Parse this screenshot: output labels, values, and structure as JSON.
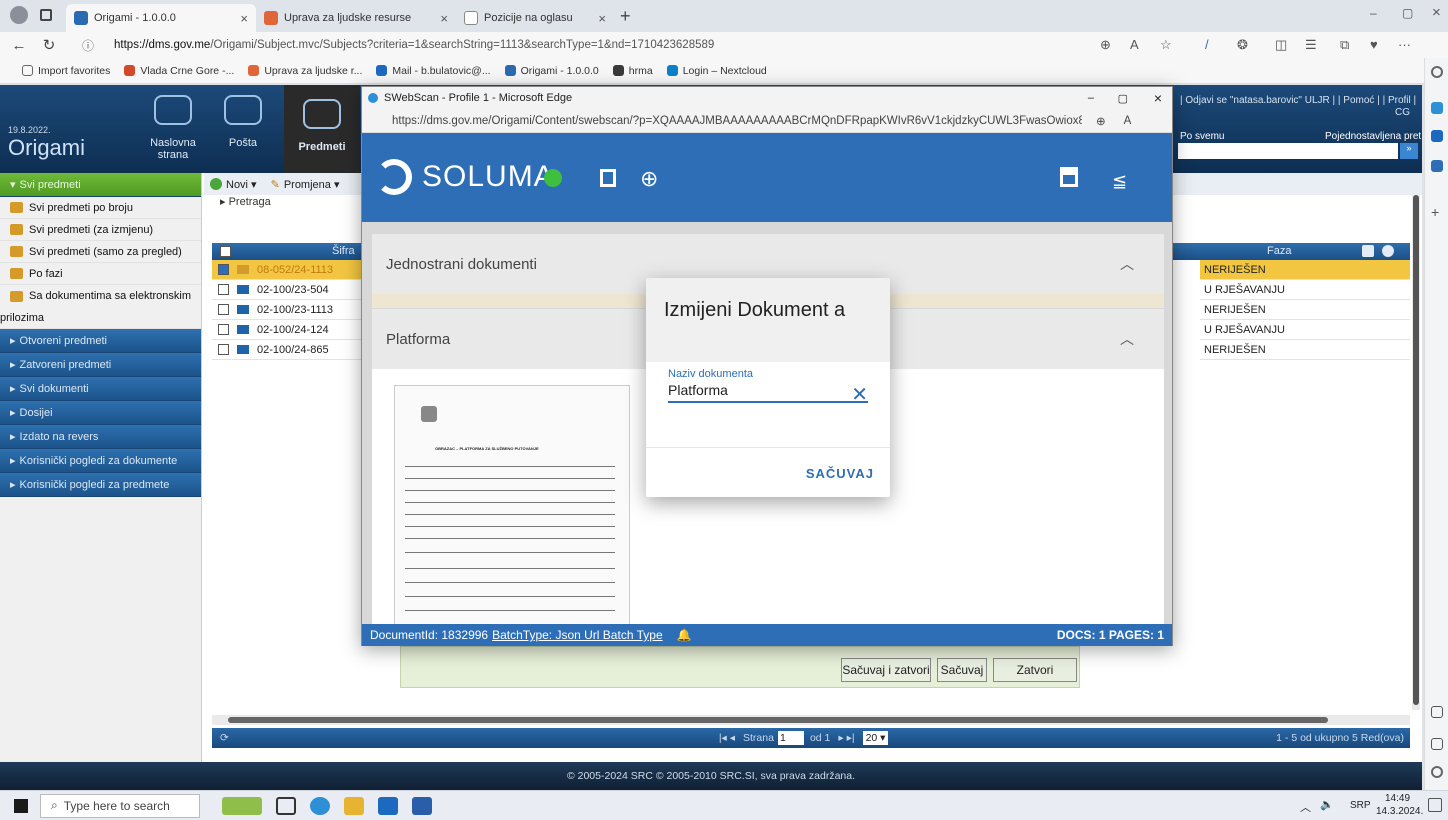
{
  "browser": {
    "tabs": [
      {
        "title": "Origami - 1.0.0.0",
        "active": true
      },
      {
        "title": "Uprava za ljudske resurse",
        "active": false
      },
      {
        "title": "Pozicije na oglasu",
        "active": false
      }
    ],
    "url_host": "https://dms.gov.me",
    "url_path": "/Origami/Subject.mvc/Subjects?criteria=1&searchString=1113&searchType=1&nd=1710423628589",
    "bookmarks": [
      "Import favorites",
      "Vlada Crne Gore -...",
      "Uprava za ljudske r...",
      "Mail - b.bulatovic@...",
      "Origami - 1.0.0.0",
      "hrma",
      "Login – Nextcloud"
    ]
  },
  "origami": {
    "date": "19.8.2022.",
    "app_name": "Origami",
    "nav": [
      "Naslovna strana",
      "Pošta",
      "Predmeti"
    ],
    "header_links": "| Odjavi se \"natasa.barovic\" ULJR | | Pomoć | | Profil |",
    "header_cg": "CG",
    "search_scope": "Po svemu",
    "search_mode": "Pojednostavljena pret",
    "sidebar_head": "Svi predmeti",
    "sidebar_items": [
      "Svi predmeti po broju",
      "Svi predmeti (za izmjenu)",
      "Svi predmeti (samo za pregled)",
      "Po fazi",
      "Sa dokumentima sa elektronskim"
    ],
    "sidebar_wrap": "prilozima",
    "sidebar_sections": [
      "Otvoreni predmeti",
      "Zatvoreni predmeti",
      "Svi dokumenti",
      "Dosijei",
      "Izdato na revers",
      "Korisnički pogledi za dokumente",
      "Korisnički pogledi za predmete"
    ],
    "toolbar": {
      "new": "Novi ▾",
      "change": "Promjena ▾"
    },
    "pretraga": "▸ Pretraga",
    "col_sifra": "Šifra",
    "col_faza": "Faza",
    "rows": [
      {
        "sifra": "08-052/24-1113",
        "faza": "NERIJEŠEN",
        "checked": true
      },
      {
        "sifra": "02-100/23-504",
        "faza": "U RJEŠAVANJU",
        "checked": false
      },
      {
        "sifra": "02-100/23-1113",
        "faza": "NERIJEŠEN",
        "checked": false
      },
      {
        "sifra": "02-100/24-124",
        "faza": "U RJEŠAVANJU",
        "checked": false
      },
      {
        "sifra": "02-100/24-865",
        "faza": "NERIJEŠEN",
        "checked": false
      }
    ],
    "pager": {
      "strana": "Strana",
      "page": "1",
      "of": "od 1",
      "size": "20 ▾",
      "summary": "1 - 5 od ukupno 5 Red(ova)"
    },
    "footer": "© 2005-2024 SRC © 2005-2010 SRC.SI, sva prava zadržana.",
    "form_buttons": [
      "Sačuvaj i zatvori",
      "Sačuvaj",
      "Zatvori"
    ]
  },
  "popup": {
    "window_title": "SWebScan - Profile 1 - Microsoft Edge",
    "url": "https://dms.gov.me/Origami/Content/swebscan/?p=XQAAAAJMBAAAAAAAAABCrMQnDFRpapKWIvR6vV1ckjdzkyCUWL3FwasOwiox81_3mTgxLV5BOJ_...",
    "brand": "SOLUMA",
    "panel1": "Jednostrani dokumenti",
    "panel2": "Platforma",
    "status_doc": "DocumentId: 1832996",
    "status_batch": "BatchType: Json Url Batch Type",
    "status_right": "DOCS: 1 PAGES: 1",
    "thumb_heading": "OBRAZAC – PLATFORMA ZA SLUŽBENO PUTOVANJE"
  },
  "dialog": {
    "title": "Izmijeni Dokument a",
    "field_label": "Naziv dokumenta",
    "field_value": "Platforma",
    "save": "SAČUVAJ"
  },
  "taskbar": {
    "search_placeholder": "Type here to search",
    "lang": "SRP",
    "time": "14:49",
    "date": "14.3.2024."
  },
  "colors": {
    "soluma_blue": "#2d6eb7",
    "origami_navy": "#1c4a7a",
    "highlight": "#f2c640",
    "sidebar_green": "#6fba38"
  }
}
